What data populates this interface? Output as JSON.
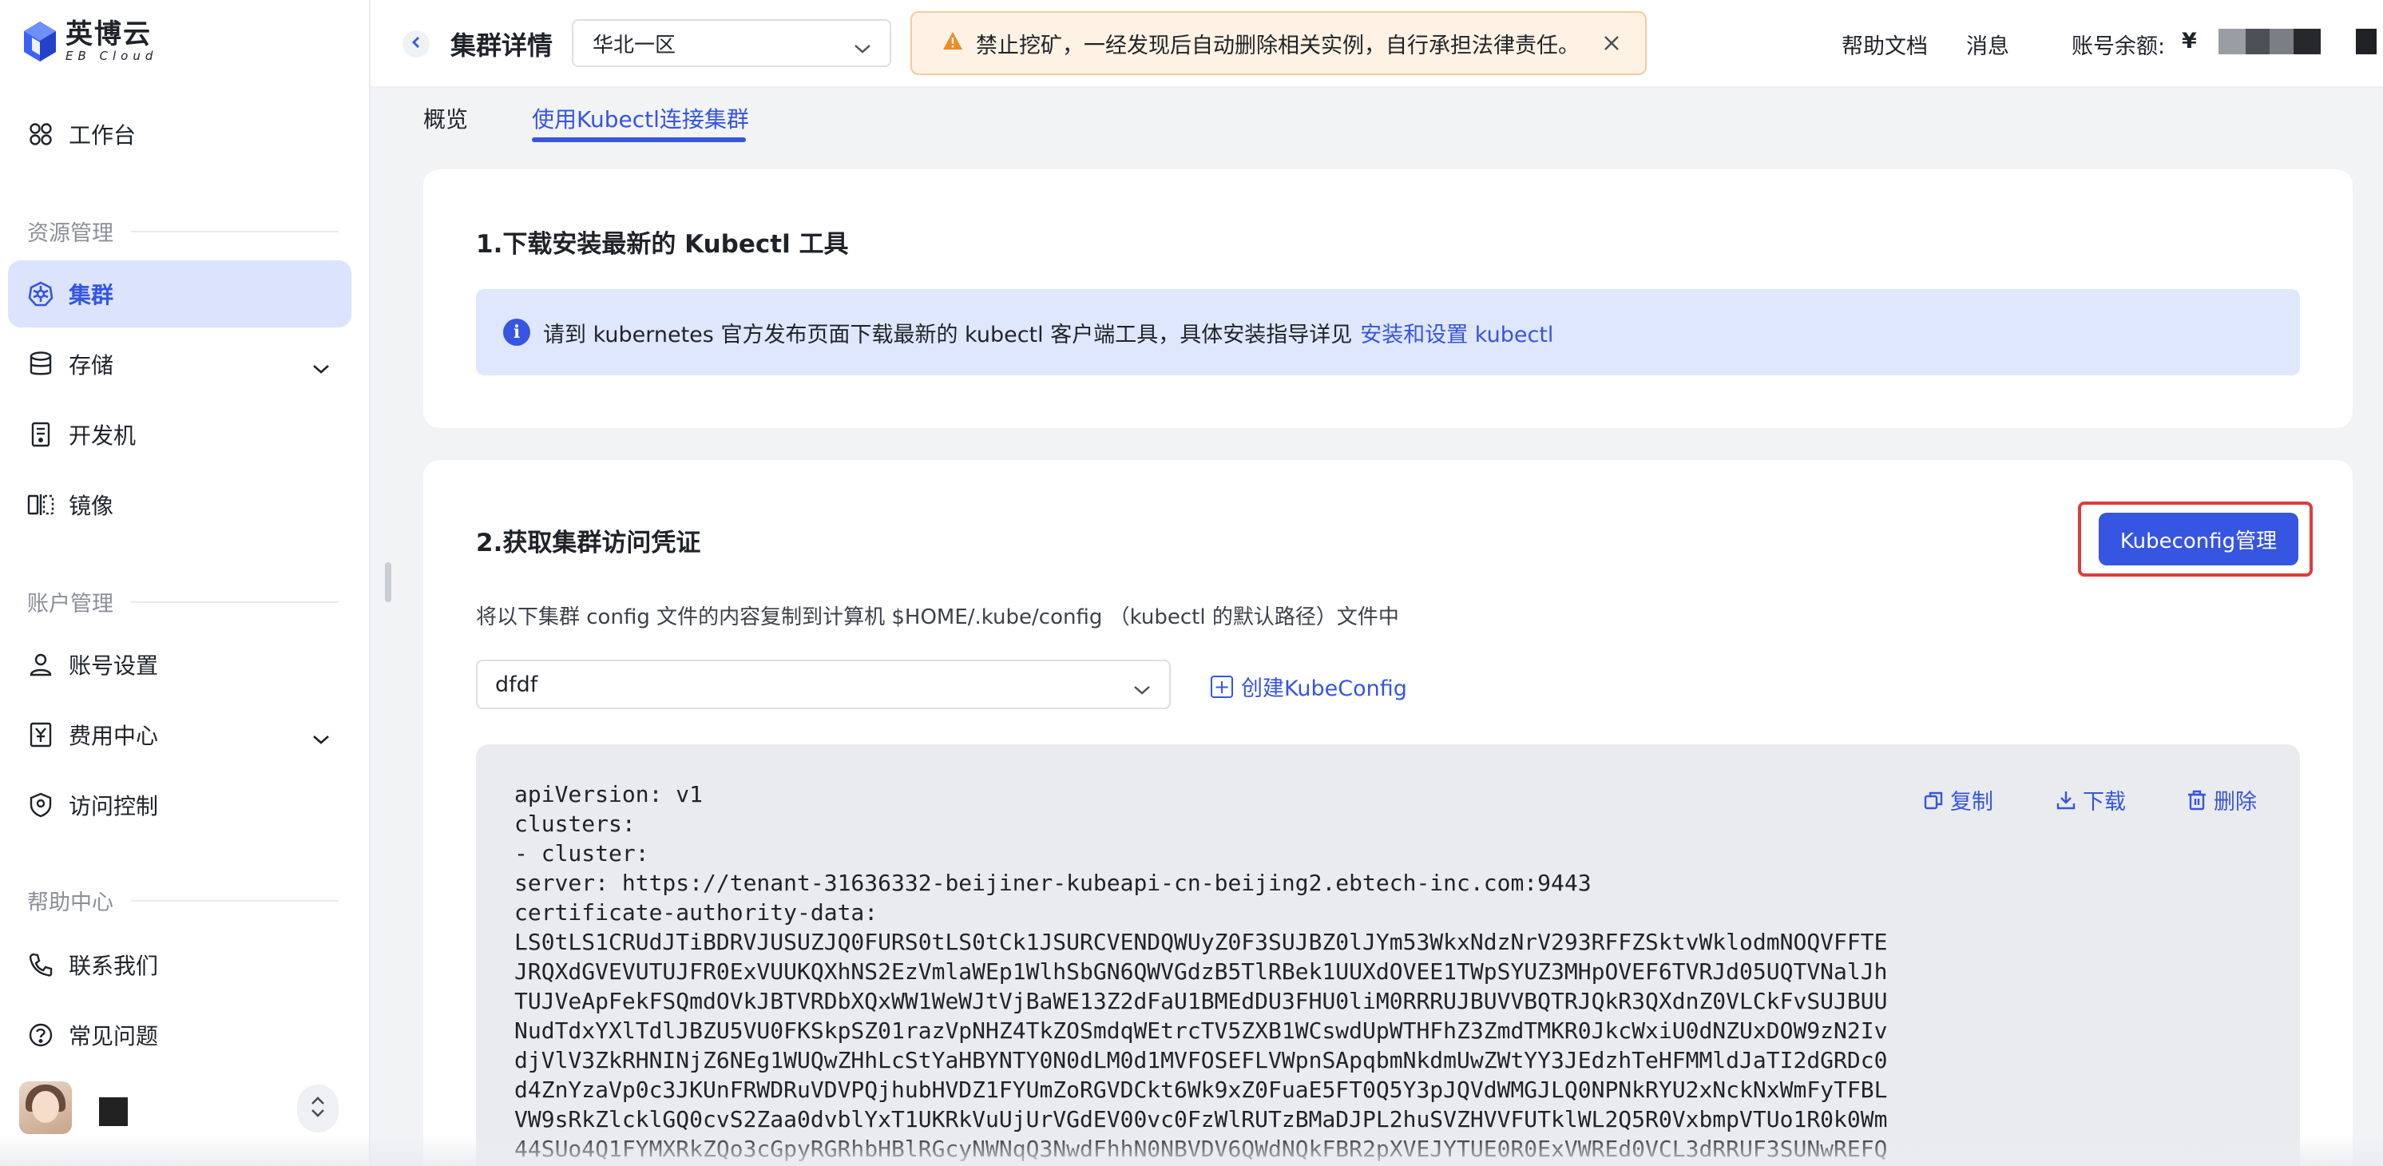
{
  "brand": {
    "name_cn": "英博云",
    "name_en": "EB Cloud"
  },
  "sidebar": {
    "workbench": "工作台",
    "section_resource": "资源管理",
    "cluster": "集群",
    "storage": "存储",
    "devmachine": "开发机",
    "image": "镜像",
    "section_account": "账户管理",
    "account_settings": "账号设置",
    "billing": "费用中心",
    "access_control": "访问控制",
    "section_help": "帮助中心",
    "contact": "联系我们",
    "faq": "常见问题"
  },
  "header": {
    "title": "集群详情",
    "region": "华北一区",
    "notice": "禁止挖矿，一经发现后自动删除相关实例，自行承担法律责任。",
    "help_docs": "帮助文档",
    "messages": "消息",
    "balance_label": "账号余额:",
    "currency": "¥"
  },
  "tabs": {
    "overview": "概览",
    "kubectl": "使用Kubectl连接集群"
  },
  "section1": {
    "title": "1.下载安装最新的 Kubectl 工具",
    "info_text": "请到 kubernetes 官方发布页面下载最新的 kubectl 客户端工具，具体安装指导详见",
    "info_link": "安装和设置 kubectl"
  },
  "section2": {
    "title": "2.获取集群访问凭证",
    "kubeconfig_button": "Kubeconfig管理",
    "description": "将以下集群 config 文件的内容复制到计算机 $HOME/.kube/config （kubectl 的默认路径）文件中",
    "selected_config": "dfdf",
    "create_link": "创建KubeConfig",
    "copy": "复制",
    "download": "下载",
    "delete": "删除",
    "code": [
      "apiVersion: v1",
      "clusters:",
      "- cluster:",
      "server: https://tenant-31636332-beijiner-kubeapi-cn-beijing2.ebtech-inc.com:9443",
      "certificate-authority-data:",
      "LS0tLS1CRUdJTiBDRVJUSUZJQ0FURS0tLS0tCk1JSURCVENDQWUyZ0F3SUJBZ0lJYm53WkxNdzNrV293RFFZSktvWklodmNOQVFFTE",
      "JRQXdGVEVUTUJFR0ExVUUKQXhNS2EzVmlaWEp1WlhSbGN6QWVGdzB5TlRBek1UUXdOVEE1TWpSYUZ3MHpOVEF6TVRJd05UQTVNalJh",
      "TUJVeApFekFSQmdOVkJBTVRDbXQxWW1WeWJtVjBaWE13Z2dFaU1BMEdDU3FHU0liM0RRRUJBUVVBQTRJQkR3QXdnZ0VLCkFvSUJBUU",
      "NudTdxYXlTdlJBZU5VU0FKSkpSZ01razVpNHZ4TkZOSmdqWEtrcTV5ZXB1WCswdUpWTHFhZ3ZmdTMKR0JkcWxiU0dNZUxDOW9zN2Iv",
      "djVlV3ZkRHNINjZ6NEg1WUQwZHhLcStYaHBYNTY0N0dLM0d1MVFOSEFLVWpnSApqbmNkdmUwZWtYY3JEdzhTeHFMMldJaTI2dGRDc0",
      "d4ZnYzaVp0c3JKUnFRWDRuVDVPQjhubHVDZ1FYUmZoRGVDCkt6Wk9xZ0FuaE5FT0Q5Y3pJQVdWMGJLQ0NPNkRYU2xNckNxWmFyTFBL",
      "VW9sRkZlcklGQ0cvS2Zaa0dvblYxT1UKRkVuUjUrVGdEV00vc0FzWlRUTzBMaDJPL2huSVZHVVFUTklWL2Q5R0VxbmpVTUo1R0k0Wm",
      "44SUo4Q1FYMXRkZQo3cGpyRGRhbHBlRGcyNWNqQ3NwdFhhN0NBVDV6QWdNQkFBR2pXVEJYTUE0R0ExVWREd0VCL3dRRUF3SUNwREFQ"
    ]
  }
}
